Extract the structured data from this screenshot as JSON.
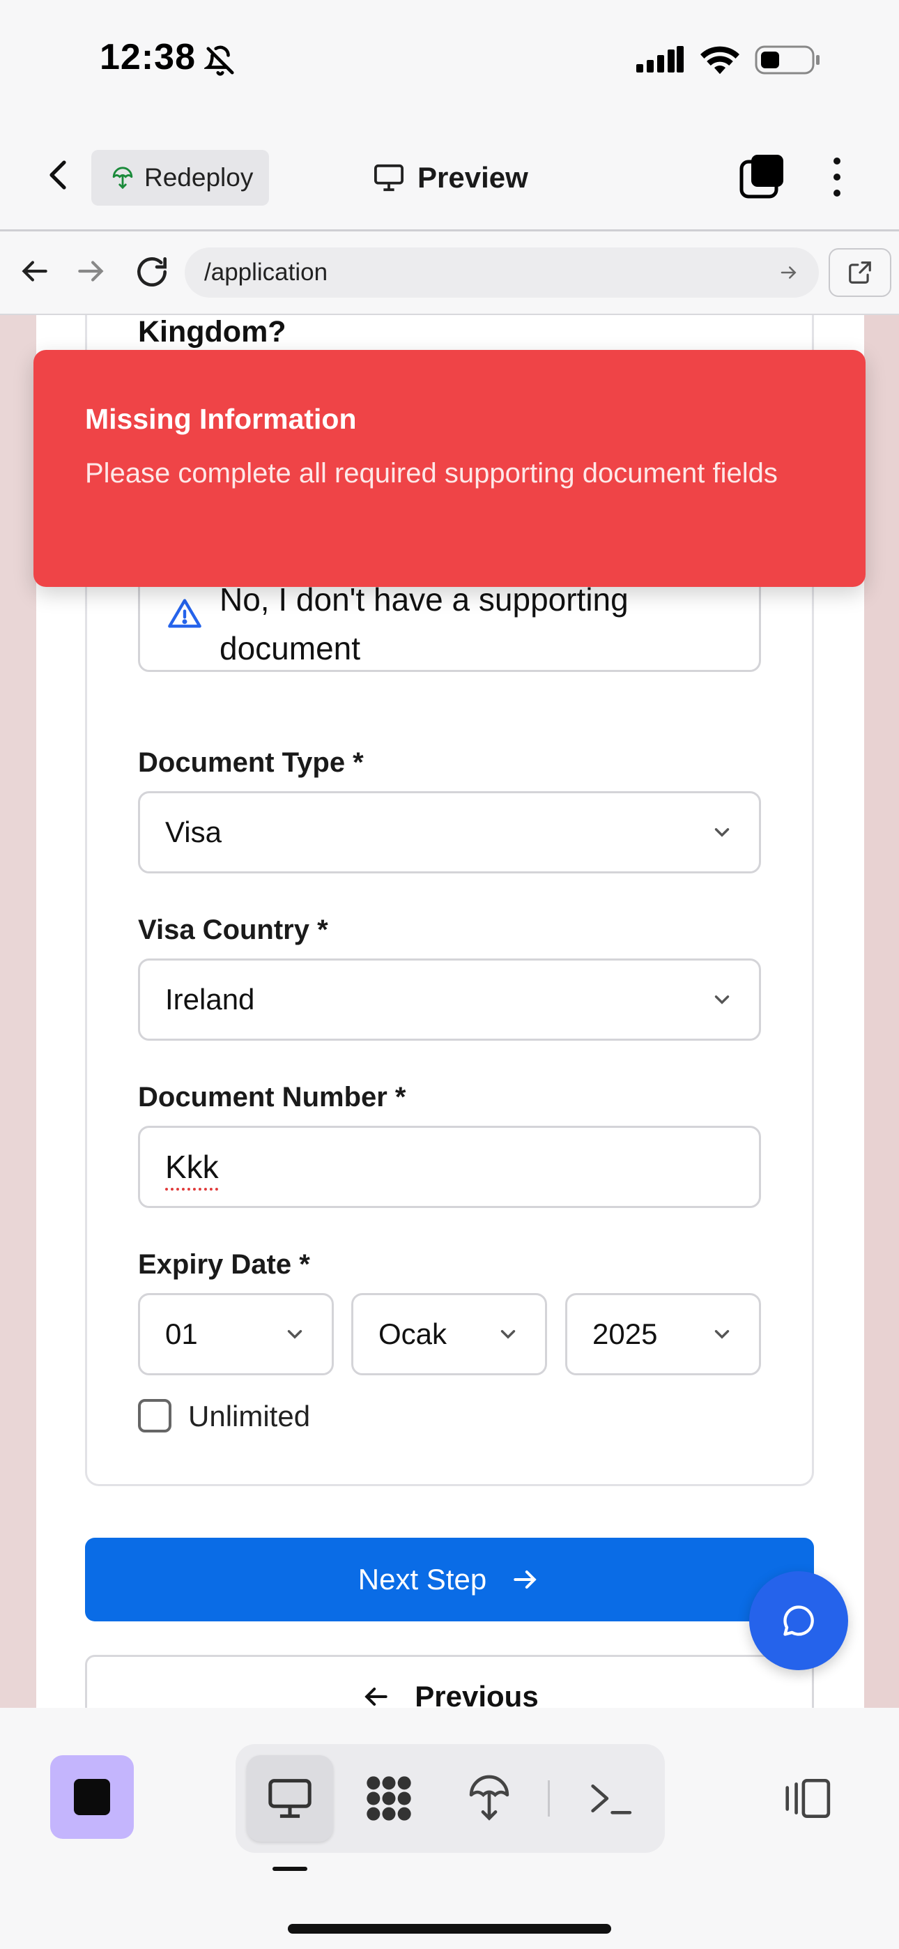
{
  "status_bar": {
    "time": "12:38"
  },
  "toolbar": {
    "redeploy_label": "Redeploy",
    "preview_label": "Preview"
  },
  "browser": {
    "url": "/application"
  },
  "form": {
    "question_tail": "Kingdom?",
    "no_document_option": "No, I don't have a supporting document",
    "document_type": {
      "label": "Document Type *",
      "value": "Visa"
    },
    "visa_country": {
      "label": "Visa Country *",
      "value": "Ireland"
    },
    "document_number": {
      "label": "Document Number *",
      "value": "Kkk"
    },
    "expiry_date": {
      "label": "Expiry Date *",
      "day": "01",
      "month": "Ocak",
      "year": "2025"
    },
    "unlimited_label": "Unlimited",
    "next_label": "Next Step",
    "previous_label": "Previous"
  },
  "toast": {
    "title": "Missing Information",
    "message": "Please complete all required supporting document fields"
  },
  "colors": {
    "toast_bg": "#ef4447",
    "primary_button": "#0a6ce6",
    "chat_fab": "#2563eb",
    "stop_button": "#c4b5fd"
  },
  "icons": {
    "dock": [
      "desktop-icon",
      "apps-grid-icon",
      "deploy-icon",
      "terminal-icon"
    ]
  }
}
